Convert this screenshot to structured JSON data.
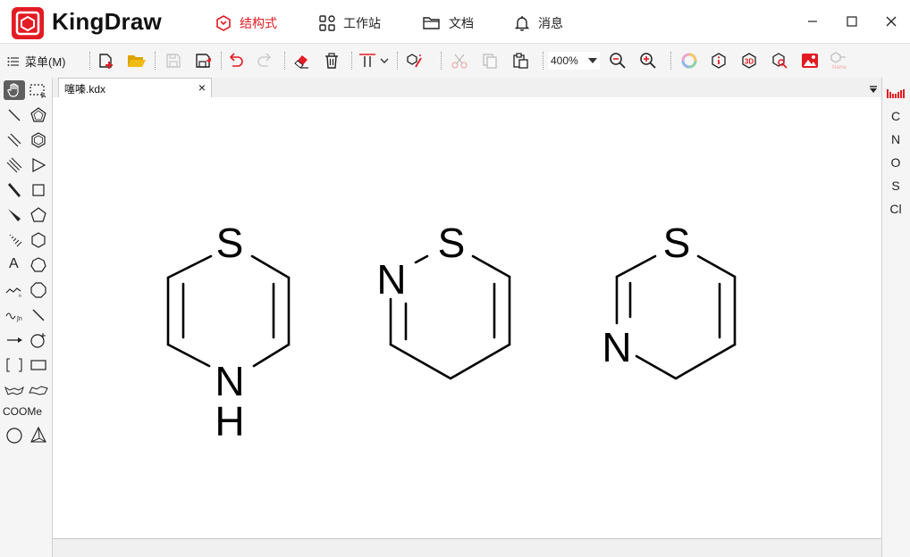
{
  "app": {
    "name": "KingDraw"
  },
  "nav": [
    {
      "label": "结构式",
      "icon": "structure-icon",
      "active": true
    },
    {
      "label": "工作站",
      "icon": "workstation-icon",
      "active": false
    },
    {
      "label": "文档",
      "icon": "folder-icon",
      "active": false
    },
    {
      "label": "消息",
      "icon": "bell-icon",
      "active": false
    }
  ],
  "toolbar": {
    "menu_label": "菜单(M)",
    "zoom_value": "400%"
  },
  "left_tools": {
    "text_tool": "A",
    "coome_label": "COOMe"
  },
  "tab": {
    "name": "噻嗪.kdx",
    "close": "×"
  },
  "elements": [
    "C",
    "N",
    "O",
    "S",
    "Cl"
  ],
  "molecules": [
    {
      "atoms": [
        "S",
        "N",
        "H"
      ]
    },
    {
      "atoms": [
        "S",
        "N"
      ]
    },
    {
      "atoms": [
        "S",
        "N"
      ]
    }
  ],
  "colors": {
    "brand": "#e31b23",
    "accent": "#e31b23"
  }
}
